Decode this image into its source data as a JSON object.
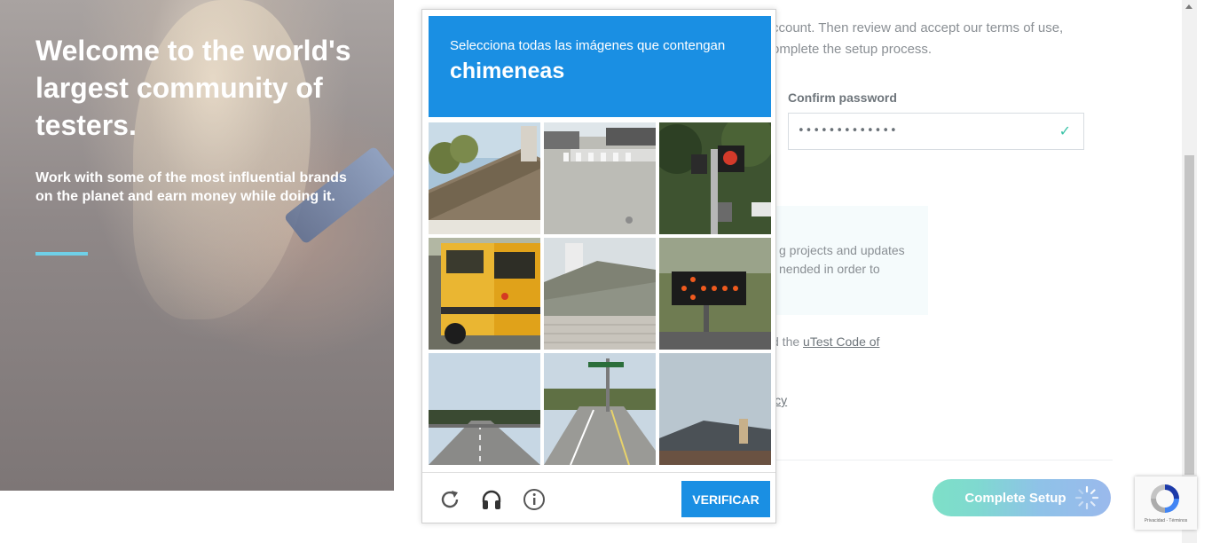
{
  "hero": {
    "title": "Welcome to the world's largest community of testers.",
    "subtitle": "Work with some of the most influential brands on the planet and earn money while doing it."
  },
  "form": {
    "intro": "ccount. Then review and accept our terms of use, omplete the setup process.",
    "confirm_label": "Confirm password",
    "confirm_value": "•••••••••••••",
    "info_text": "g projects and updates nended in order to",
    "code_prefix": "d the ",
    "code_link": "uTest Code of",
    "policy_text": "icy",
    "complete_label": "Complete Setup"
  },
  "captcha": {
    "instruction": "Selecciona todas las imágenes que contengan",
    "target": "chimeneas",
    "verify_label": "VERIFICAR",
    "tiles": [
      "house-roof",
      "parking-lot",
      "traffic-signal",
      "school-bus",
      "house-roof-chimney",
      "arrow-board",
      "highway-road",
      "intersection",
      "houses-chimney"
    ]
  },
  "recaptcha_badge": {
    "text": "Privacidad - Términos"
  }
}
